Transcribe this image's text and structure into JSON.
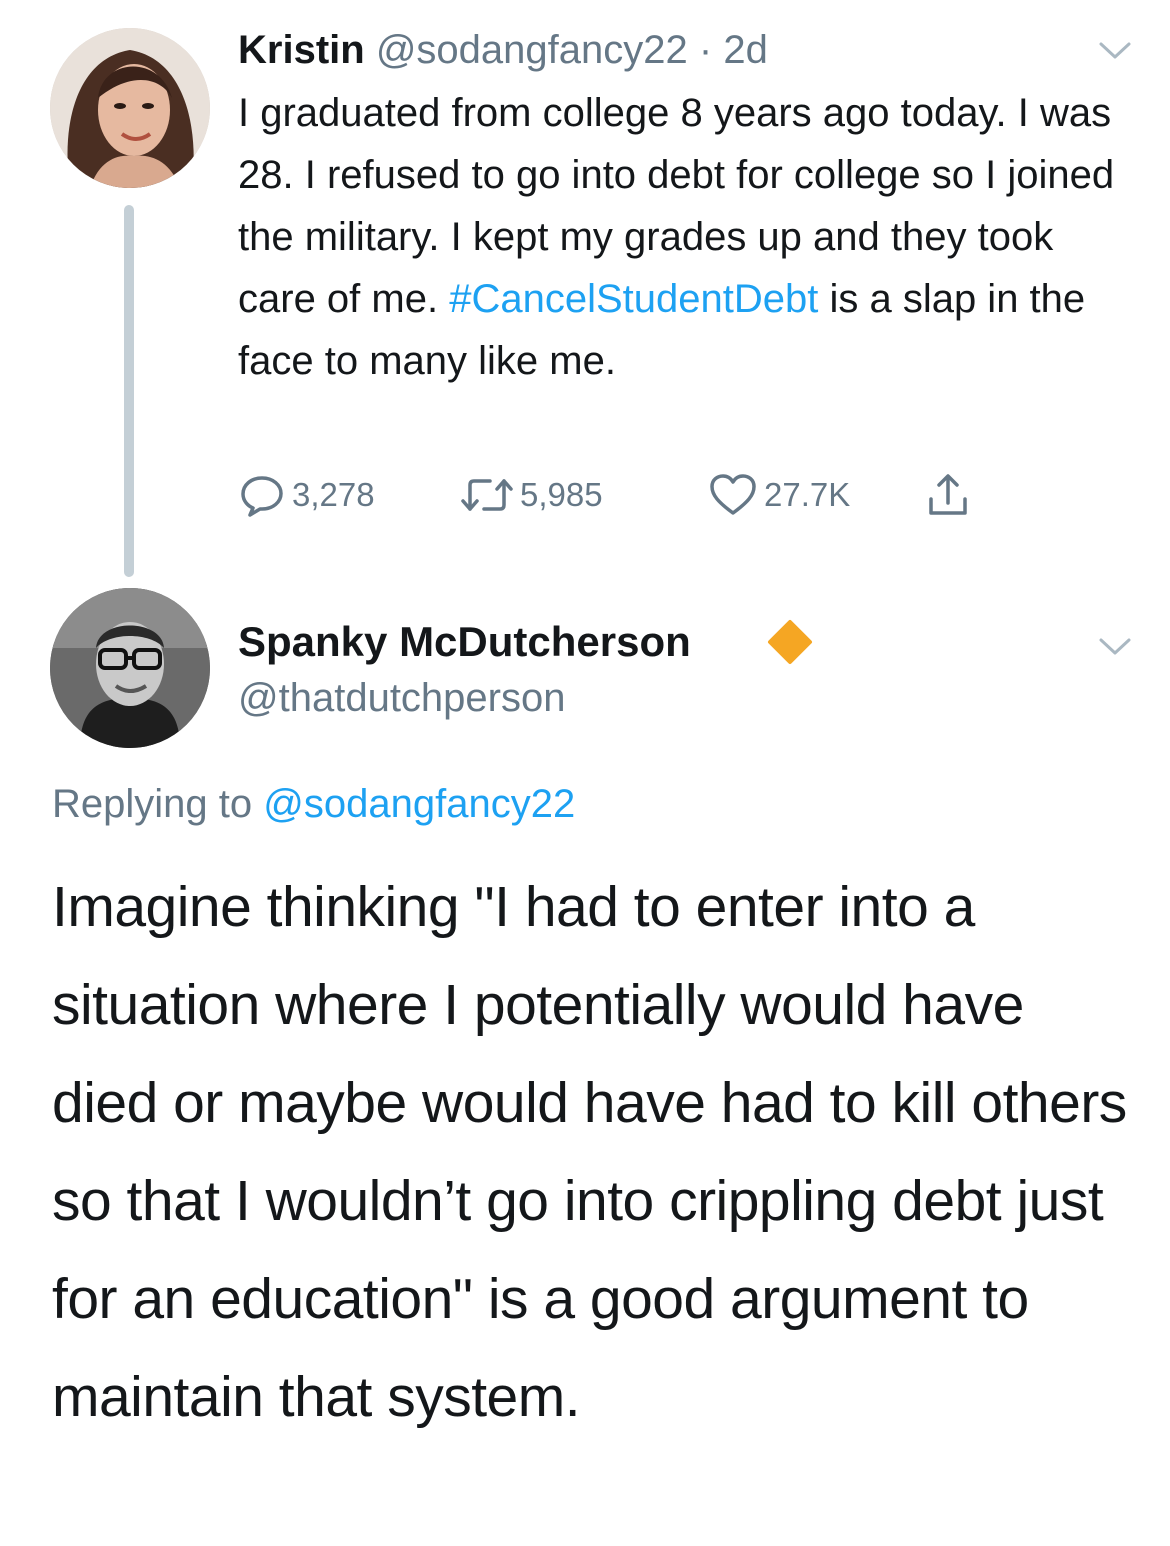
{
  "tweet1": {
    "author_name": "Kristin",
    "handle": "@sodangfancy22",
    "separator": "·",
    "time": "2d",
    "text_before_hashtag": "I graduated from college 8 years ago today. I was 28. I refused to go into debt for college so I joined the military. I kept my grades up and they took care of me. ",
    "hashtag": "#CancelStudentDebt",
    "text_after_hashtag": " is a slap in the face to many like me.",
    "replies": "3,278",
    "retweets": "5,985",
    "likes": "27.7K"
  },
  "tweet2": {
    "author_name": "Spanky McDutcherson",
    "handle": "@thatdutchperson",
    "replying_prefix": "Replying to",
    "replying_handle": "@sodangfancy22",
    "text": "Imagine thinking \"I had to enter into a situation where I potentially would have died or maybe would have had to kill others so that I wouldn’t go into crippling debt just for an education\" is a good argument to maintain that system."
  },
  "icons": {
    "reply": "reply-icon",
    "retweet": "retweet-icon",
    "like": "heart-icon",
    "share": "share-icon",
    "menu": "chevron-down-icon",
    "badge": "diamond-badge-icon"
  },
  "colors": {
    "link": "#1da1f2",
    "muted": "#657786",
    "text": "#14171a",
    "badge": "#f5a623"
  }
}
